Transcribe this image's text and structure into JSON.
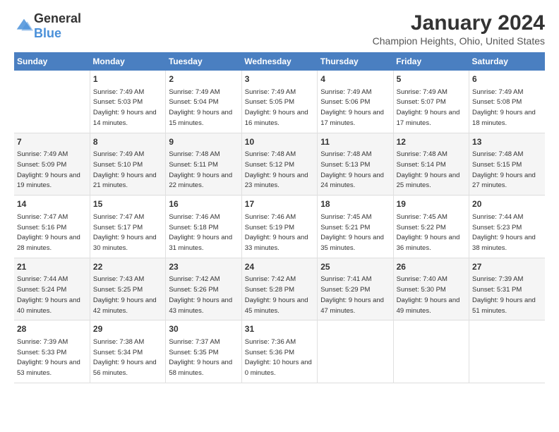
{
  "header": {
    "logo_general": "General",
    "logo_blue": "Blue",
    "title": "January 2024",
    "location": "Champion Heights, Ohio, United States"
  },
  "days_of_week": [
    "Sunday",
    "Monday",
    "Tuesday",
    "Wednesday",
    "Thursday",
    "Friday",
    "Saturday"
  ],
  "weeks": [
    [
      {
        "day": "",
        "sunrise": "",
        "sunset": "",
        "daylight": ""
      },
      {
        "day": "1",
        "sunrise": "Sunrise: 7:49 AM",
        "sunset": "Sunset: 5:03 PM",
        "daylight": "Daylight: 9 hours and 14 minutes."
      },
      {
        "day": "2",
        "sunrise": "Sunrise: 7:49 AM",
        "sunset": "Sunset: 5:04 PM",
        "daylight": "Daylight: 9 hours and 15 minutes."
      },
      {
        "day": "3",
        "sunrise": "Sunrise: 7:49 AM",
        "sunset": "Sunset: 5:05 PM",
        "daylight": "Daylight: 9 hours and 16 minutes."
      },
      {
        "day": "4",
        "sunrise": "Sunrise: 7:49 AM",
        "sunset": "Sunset: 5:06 PM",
        "daylight": "Daylight: 9 hours and 17 minutes."
      },
      {
        "day": "5",
        "sunrise": "Sunrise: 7:49 AM",
        "sunset": "Sunset: 5:07 PM",
        "daylight": "Daylight: 9 hours and 17 minutes."
      },
      {
        "day": "6",
        "sunrise": "Sunrise: 7:49 AM",
        "sunset": "Sunset: 5:08 PM",
        "daylight": "Daylight: 9 hours and 18 minutes."
      }
    ],
    [
      {
        "day": "7",
        "sunrise": "Sunrise: 7:49 AM",
        "sunset": "Sunset: 5:09 PM",
        "daylight": "Daylight: 9 hours and 19 minutes."
      },
      {
        "day": "8",
        "sunrise": "Sunrise: 7:49 AM",
        "sunset": "Sunset: 5:10 PM",
        "daylight": "Daylight: 9 hours and 21 minutes."
      },
      {
        "day": "9",
        "sunrise": "Sunrise: 7:48 AM",
        "sunset": "Sunset: 5:11 PM",
        "daylight": "Daylight: 9 hours and 22 minutes."
      },
      {
        "day": "10",
        "sunrise": "Sunrise: 7:48 AM",
        "sunset": "Sunset: 5:12 PM",
        "daylight": "Daylight: 9 hours and 23 minutes."
      },
      {
        "day": "11",
        "sunrise": "Sunrise: 7:48 AM",
        "sunset": "Sunset: 5:13 PM",
        "daylight": "Daylight: 9 hours and 24 minutes."
      },
      {
        "day": "12",
        "sunrise": "Sunrise: 7:48 AM",
        "sunset": "Sunset: 5:14 PM",
        "daylight": "Daylight: 9 hours and 25 minutes."
      },
      {
        "day": "13",
        "sunrise": "Sunrise: 7:48 AM",
        "sunset": "Sunset: 5:15 PM",
        "daylight": "Daylight: 9 hours and 27 minutes."
      }
    ],
    [
      {
        "day": "14",
        "sunrise": "Sunrise: 7:47 AM",
        "sunset": "Sunset: 5:16 PM",
        "daylight": "Daylight: 9 hours and 28 minutes."
      },
      {
        "day": "15",
        "sunrise": "Sunrise: 7:47 AM",
        "sunset": "Sunset: 5:17 PM",
        "daylight": "Daylight: 9 hours and 30 minutes."
      },
      {
        "day": "16",
        "sunrise": "Sunrise: 7:46 AM",
        "sunset": "Sunset: 5:18 PM",
        "daylight": "Daylight: 9 hours and 31 minutes."
      },
      {
        "day": "17",
        "sunrise": "Sunrise: 7:46 AM",
        "sunset": "Sunset: 5:19 PM",
        "daylight": "Daylight: 9 hours and 33 minutes."
      },
      {
        "day": "18",
        "sunrise": "Sunrise: 7:45 AM",
        "sunset": "Sunset: 5:21 PM",
        "daylight": "Daylight: 9 hours and 35 minutes."
      },
      {
        "day": "19",
        "sunrise": "Sunrise: 7:45 AM",
        "sunset": "Sunset: 5:22 PM",
        "daylight": "Daylight: 9 hours and 36 minutes."
      },
      {
        "day": "20",
        "sunrise": "Sunrise: 7:44 AM",
        "sunset": "Sunset: 5:23 PM",
        "daylight": "Daylight: 9 hours and 38 minutes."
      }
    ],
    [
      {
        "day": "21",
        "sunrise": "Sunrise: 7:44 AM",
        "sunset": "Sunset: 5:24 PM",
        "daylight": "Daylight: 9 hours and 40 minutes."
      },
      {
        "day": "22",
        "sunrise": "Sunrise: 7:43 AM",
        "sunset": "Sunset: 5:25 PM",
        "daylight": "Daylight: 9 hours and 42 minutes."
      },
      {
        "day": "23",
        "sunrise": "Sunrise: 7:42 AM",
        "sunset": "Sunset: 5:26 PM",
        "daylight": "Daylight: 9 hours and 43 minutes."
      },
      {
        "day": "24",
        "sunrise": "Sunrise: 7:42 AM",
        "sunset": "Sunset: 5:28 PM",
        "daylight": "Daylight: 9 hours and 45 minutes."
      },
      {
        "day": "25",
        "sunrise": "Sunrise: 7:41 AM",
        "sunset": "Sunset: 5:29 PM",
        "daylight": "Daylight: 9 hours and 47 minutes."
      },
      {
        "day": "26",
        "sunrise": "Sunrise: 7:40 AM",
        "sunset": "Sunset: 5:30 PM",
        "daylight": "Daylight: 9 hours and 49 minutes."
      },
      {
        "day": "27",
        "sunrise": "Sunrise: 7:39 AM",
        "sunset": "Sunset: 5:31 PM",
        "daylight": "Daylight: 9 hours and 51 minutes."
      }
    ],
    [
      {
        "day": "28",
        "sunrise": "Sunrise: 7:39 AM",
        "sunset": "Sunset: 5:33 PM",
        "daylight": "Daylight: 9 hours and 53 minutes."
      },
      {
        "day": "29",
        "sunrise": "Sunrise: 7:38 AM",
        "sunset": "Sunset: 5:34 PM",
        "daylight": "Daylight: 9 hours and 56 minutes."
      },
      {
        "day": "30",
        "sunrise": "Sunrise: 7:37 AM",
        "sunset": "Sunset: 5:35 PM",
        "daylight": "Daylight: 9 hours and 58 minutes."
      },
      {
        "day": "31",
        "sunrise": "Sunrise: 7:36 AM",
        "sunset": "Sunset: 5:36 PM",
        "daylight": "Daylight: 10 hours and 0 minutes."
      },
      {
        "day": "",
        "sunrise": "",
        "sunset": "",
        "daylight": ""
      },
      {
        "day": "",
        "sunrise": "",
        "sunset": "",
        "daylight": ""
      },
      {
        "day": "",
        "sunrise": "",
        "sunset": "",
        "daylight": ""
      }
    ]
  ]
}
